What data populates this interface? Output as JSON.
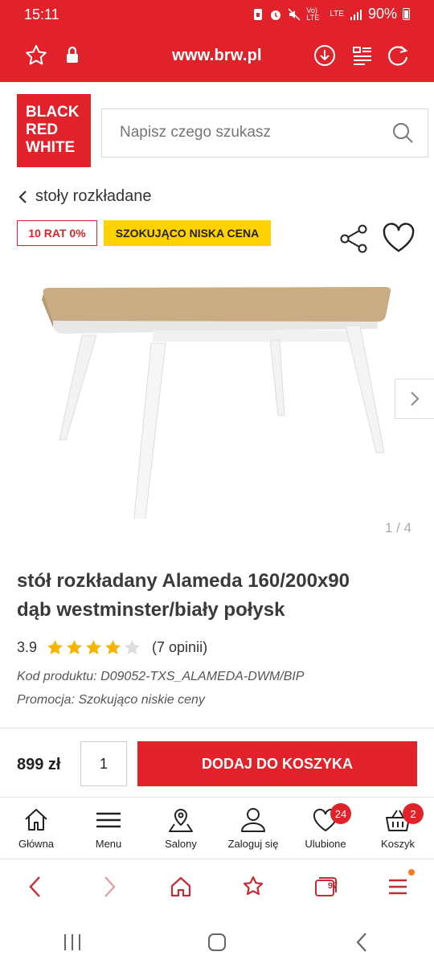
{
  "status_bar": {
    "time": "15:11",
    "battery": "90%",
    "network_1": "Vo) LTE",
    "network_2": "LTE"
  },
  "browser": {
    "url": "www.brw.pl"
  },
  "logo": {
    "line1": "BLACK",
    "line2": "RED",
    "line3": "WHITE"
  },
  "search": {
    "placeholder": "Napisz czego szukasz"
  },
  "breadcrumb": {
    "label": "stoły rozkładane"
  },
  "badges": {
    "installments": "10 RAT 0%",
    "promo": "SZOKUJĄCO NISKA CENA"
  },
  "gallery": {
    "counter": "1 / 4",
    "image_alt": "stół rozkładany Alameda"
  },
  "product": {
    "title_line1": "stół rozkładany Alameda 160/200x90",
    "title_line2": "dąb westminster/biały połysk",
    "rating": "3.9",
    "rating_stars": 3.9,
    "reviews": "(7 opinii)",
    "code": "Kod produktu: D09052-TXS_ALAMEDA-DWM/BIP",
    "promotion": "Promocja: Szokująco niskie ceny"
  },
  "buy": {
    "price": "899 zł",
    "quantity": "1",
    "add_label": "DODAJ DO KOSZYKA"
  },
  "site_nav": [
    {
      "label": "Główna",
      "icon": "home-icon"
    },
    {
      "label": "Menu",
      "icon": "menu-icon"
    },
    {
      "label": "Salony",
      "icon": "map-pin-icon"
    },
    {
      "label": "Zaloguj się",
      "icon": "user-icon"
    },
    {
      "label": "Ulubione",
      "icon": "heart-icon",
      "badge": "24"
    },
    {
      "label": "Koszyk",
      "icon": "basket-icon",
      "badge": "2"
    }
  ],
  "browser_toolbar": {
    "tabs_count": "97"
  },
  "colors": {
    "brand_red": "#e1222a",
    "promo_yellow": "#ffd200",
    "star": "#f6b400"
  }
}
